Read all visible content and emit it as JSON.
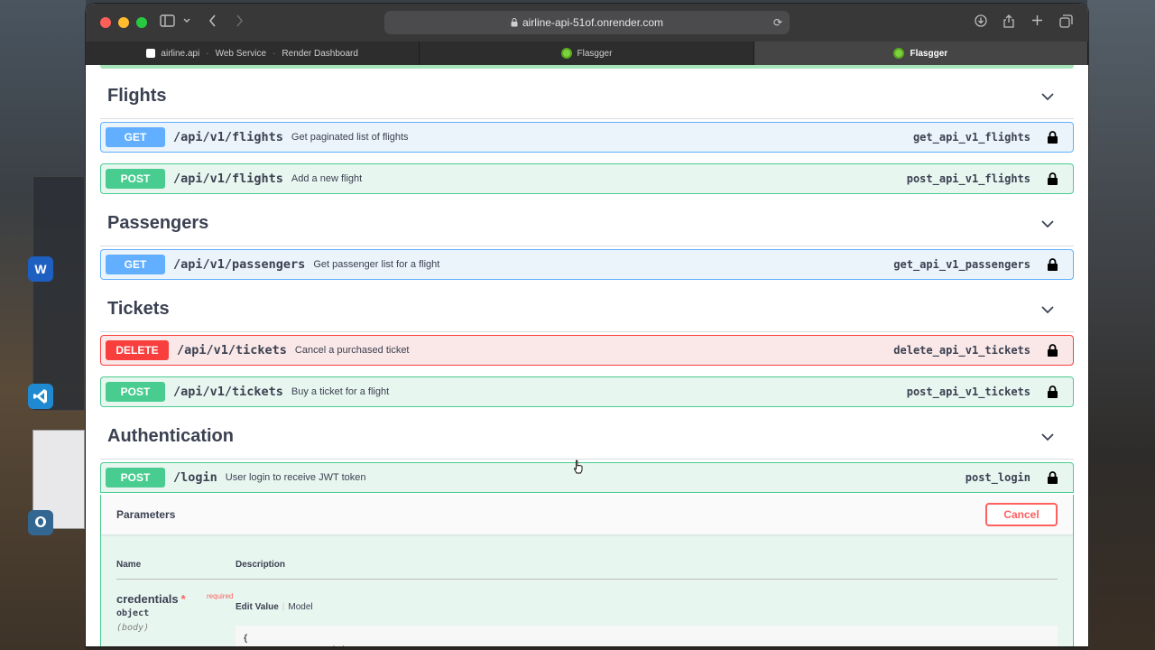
{
  "browser": {
    "url": "airline-api-51of.onrender.com",
    "tabs": [
      {
        "label": "airline.api",
        "parts": [
          "Web Service",
          "Render Dashboard"
        ]
      },
      {
        "label": "Flasgger"
      },
      {
        "label": "Flasgger"
      }
    ]
  },
  "sections": [
    {
      "title": "Flights",
      "operations": [
        {
          "method": "GET",
          "path": "/api/v1/flights",
          "summary": "Get paginated list of flights",
          "operation_id": "get_api_v1_flights"
        },
        {
          "method": "POST",
          "path": "/api/v1/flights",
          "summary": "Add a new flight",
          "operation_id": "post_api_v1_flights"
        }
      ]
    },
    {
      "title": "Passengers",
      "operations": [
        {
          "method": "GET",
          "path": "/api/v1/passengers",
          "summary": "Get passenger list for a flight",
          "operation_id": "get_api_v1_passengers"
        }
      ]
    },
    {
      "title": "Tickets",
      "operations": [
        {
          "method": "DELETE",
          "path": "/api/v1/tickets",
          "summary": "Cancel a purchased ticket",
          "operation_id": "delete_api_v1_tickets"
        },
        {
          "method": "POST",
          "path": "/api/v1/tickets",
          "summary": "Buy a ticket for a flight",
          "operation_id": "post_api_v1_tickets"
        }
      ]
    },
    {
      "title": "Authentication",
      "operations": [
        {
          "method": "POST",
          "path": "/login",
          "summary": "User login to receive JWT token",
          "operation_id": "post_login"
        }
      ]
    }
  ],
  "expanded": {
    "parameters_title": "Parameters",
    "cancel_label": "Cancel",
    "col_name": "Name",
    "col_description": "Description",
    "param": {
      "name": "credentials",
      "star": "*",
      "required": "required",
      "type": "object",
      "in": "(body)"
    },
    "edit_value": "Edit Value",
    "model": "Model",
    "code": "{\n  \"username\": \"admin\","
  },
  "colors": {
    "get": "#61affe",
    "post": "#49cc90",
    "delete": "#f93e3e"
  }
}
